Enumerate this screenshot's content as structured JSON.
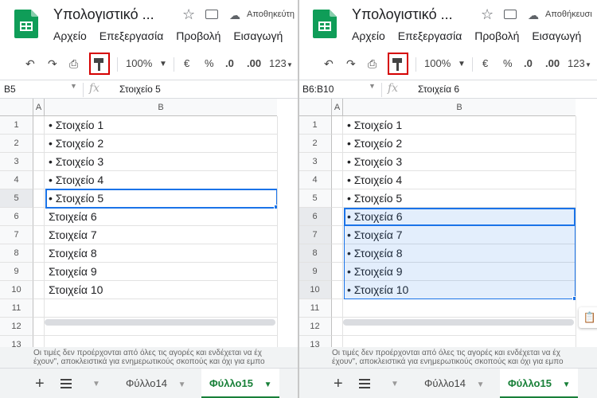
{
  "left": {
    "doc_title": "Υπολογιστικό ...",
    "save_status": "Αποθηκεύτη",
    "menu": [
      "Αρχείο",
      "Επεξεργασία",
      "Προβολή",
      "Εισαγωγή"
    ],
    "zoom": "100%",
    "currency": "€",
    "percent": "%",
    "dec_less": ".0",
    "dec_more": ".00",
    "num_format": "123",
    "name_box": "B5",
    "fx": "fx",
    "formula": "Στοιχείο 5",
    "col_a": "A",
    "col_b": "B",
    "rows": [
      "1",
      "2",
      "3",
      "4",
      "5",
      "6",
      "7",
      "8",
      "9",
      "10",
      "11",
      "12",
      "13"
    ],
    "cells": [
      "• Στοιχείο 1",
      "• Στοιχείο 2",
      "• Στοιχείο 3",
      "• Στοιχείο 4",
      "• Στοιχείο 5",
      "Στοιχεία 6",
      "Στοιχεία 7",
      "Στοιχεία 8",
      "Στοιχεία 9",
      "Στοιχεία 10",
      "",
      "",
      ""
    ],
    "disclaimer_1": "Οι τιμές δεν προέρχονται από όλες τις αγορές και ενδέχεται να έχ",
    "disclaimer_2": "έχουν\", αποκλειστικά για ενημερωτικούς σκοπούς και όχι για εμπο",
    "tab_1": "Φύλλο14",
    "tab_2": "Φύλλο15"
  },
  "right": {
    "doc_title": "Υπολογιστικό ...",
    "save_status": "Αποθήκευσι",
    "menu": [
      "Αρχείο",
      "Επεξεργασία",
      "Προβολή",
      "Εισαγωγή"
    ],
    "zoom": "100%",
    "currency": "€",
    "percent": "%",
    "dec_less": ".0",
    "dec_more": ".00",
    "num_format": "123",
    "name_box": "B6:B10",
    "fx": "fx",
    "formula": "Στοιχεία 6",
    "col_a": "A",
    "col_b": "B",
    "rows": [
      "1",
      "2",
      "3",
      "4",
      "5",
      "6",
      "7",
      "8",
      "9",
      "10",
      "11",
      "12",
      "13"
    ],
    "cells": [
      "• Στοιχείο 1",
      "• Στοιχείο 2",
      "• Στοιχείο 3",
      "• Στοιχείο 4",
      "• Στοιχείο 5",
      "• Στοιχεία 6",
      "• Στοιχεία 7",
      "• Στοιχεία 8",
      "• Στοιχεία 9",
      "• Στοιχεία 10",
      "",
      "",
      ""
    ],
    "disclaimer_1": "Οι τιμές δεν προέρχονται από όλες τις αγορές και ενδέχεται να έχ",
    "disclaimer_2": "έχουν\", αποκλειστικά για ενημερωτικούς σκοπούς και όχι για εμπο",
    "tab_1": "Φύλλο14",
    "tab_2": "Φύλλο15"
  },
  "colors": {
    "accent": "#1a73e8",
    "sheets_green": "#188038",
    "highlight_red": "#d50000"
  }
}
